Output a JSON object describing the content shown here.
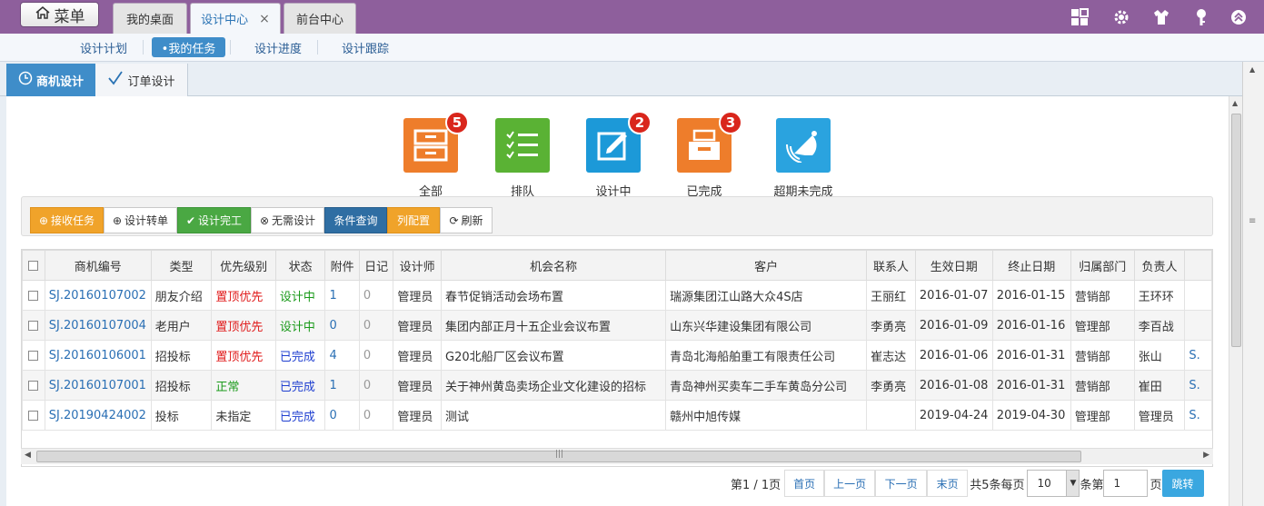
{
  "topbar": {
    "menu_label": "菜单",
    "tabs": [
      {
        "label": "我的桌面",
        "active": false
      },
      {
        "label": "设计中心",
        "active": true,
        "close": "×"
      },
      {
        "label": "前台中心",
        "active": false
      }
    ],
    "icons": [
      "grid-icon",
      "gear-icon",
      "shirt-icon",
      "key-icon",
      "chevron-up-icon"
    ],
    "color": "#8e5f9c"
  },
  "subnav": {
    "items": [
      {
        "label": "设计计划",
        "active": false
      },
      {
        "label": "•我的任务",
        "active": true
      },
      {
        "label": "设计进度",
        "active": false
      },
      {
        "label": "设计跟踪",
        "active": false
      }
    ]
  },
  "page_tabs": [
    {
      "label": "商机设计",
      "icon": "clock-icon",
      "active": true
    },
    {
      "label": "订单设计",
      "icon": "check-icon",
      "active": false
    }
  ],
  "stats": [
    {
      "label": "全部",
      "badge": "5",
      "color": "#ee7d2b",
      "icon": "cabinet-icon"
    },
    {
      "label": "排队",
      "badge": "",
      "color": "#5ab234",
      "icon": "list-icon"
    },
    {
      "label": "设计中",
      "badge": "2",
      "color": "#1c99d8",
      "icon": "edit-icon"
    },
    {
      "label": "已完成",
      "badge": "3",
      "color": "#ee7d2b",
      "icon": "inbox-icon"
    },
    {
      "label": "超期未完成",
      "badge": "",
      "color": "#2aa3df",
      "icon": "bell-icon"
    }
  ],
  "toolbar": {
    "receive": "接收任务",
    "transfer": "设计转单",
    "complete": "设计完工",
    "no_design": "无需设计",
    "query": "条件查询",
    "columns": "列配置",
    "refresh": "刷新"
  },
  "table": {
    "headers": [
      "商机编号",
      "类型",
      "优先级别",
      "状态",
      "附件",
      "日记",
      "设计师",
      "机会名称",
      "客户",
      "联系人",
      "生效日期",
      "终止日期",
      "归属部门",
      "负责人"
    ],
    "rows": [
      {
        "id": "SJ.20160107002",
        "type": "朋友介绍",
        "priority": "置顶优先",
        "priority_color": "#e01b1b",
        "status": "设计中",
        "status_color": "#1a9a1a",
        "attach": "1",
        "diary": "0",
        "designer": "管理员",
        "name": "春节促销活动会场布置",
        "customer": "瑞源集团江山路大众4S店",
        "contact": "王丽红",
        "start": "2016-01-07",
        "end": "2016-01-15",
        "dept": "营销部",
        "owner": "王环环",
        "extra": ""
      },
      {
        "id": "SJ.20160107004",
        "type": "老用户",
        "priority": "置顶优先",
        "priority_color": "#e01b1b",
        "status": "设计中",
        "status_color": "#1a9a1a",
        "attach": "0",
        "diary": "0",
        "designer": "管理员",
        "name": "集团内部正月十五企业会议布置",
        "customer": "山东兴华建设集团有限公司",
        "contact": "李勇亮",
        "start": "2016-01-09",
        "end": "2016-01-16",
        "dept": "管理部",
        "owner": "李百战",
        "extra": ""
      },
      {
        "id": "SJ.20160106001",
        "type": "招投标",
        "priority": "置顶优先",
        "priority_color": "#e01b1b",
        "status": "已完成",
        "status_color": "#1f3fd0",
        "attach": "4",
        "diary": "0",
        "designer": "管理员",
        "name": "G20北船厂区会议布置",
        "customer": "青岛北海船舶重工有限责任公司",
        "contact": "崔志达",
        "start": "2016-01-06",
        "end": "2016-01-31",
        "dept": "营销部",
        "owner": "张山",
        "extra": "S."
      },
      {
        "id": "SJ.20160107001",
        "type": "招投标",
        "priority": "正常",
        "priority_color": "#1a9a1a",
        "status": "已完成",
        "status_color": "#1f3fd0",
        "attach": "1",
        "diary": "0",
        "designer": "管理员",
        "name": "关于神州黄岛卖场企业文化建设的招标",
        "customer": "青岛神州买卖车二手车黄岛分公司",
        "contact": "李勇亮",
        "start": "2016-01-08",
        "end": "2016-01-31",
        "dept": "营销部",
        "owner": "崔田",
        "extra": "S."
      },
      {
        "id": "SJ.20190424002",
        "type": "投标",
        "priority": "未指定",
        "priority_color": "#333333",
        "status": "已完成",
        "status_color": "#1f3fd0",
        "attach": "0",
        "diary": "0",
        "designer": "管理员",
        "name": "测试",
        "customer": "赣州中旭传媒",
        "contact": "",
        "start": "2019-04-24",
        "end": "2019-04-30",
        "dept": "管理部",
        "owner": "管理员",
        "extra": "S."
      }
    ]
  },
  "pager": {
    "page_info": "第1 / 1页",
    "first": "首页",
    "prev": "上一页",
    "next": "下一页",
    "last": "末页",
    "total": "共5条每页",
    "page_size": "10",
    "per_suffix": "条第",
    "page_input": "1",
    "page_suffix": "页",
    "go": "跳转"
  }
}
